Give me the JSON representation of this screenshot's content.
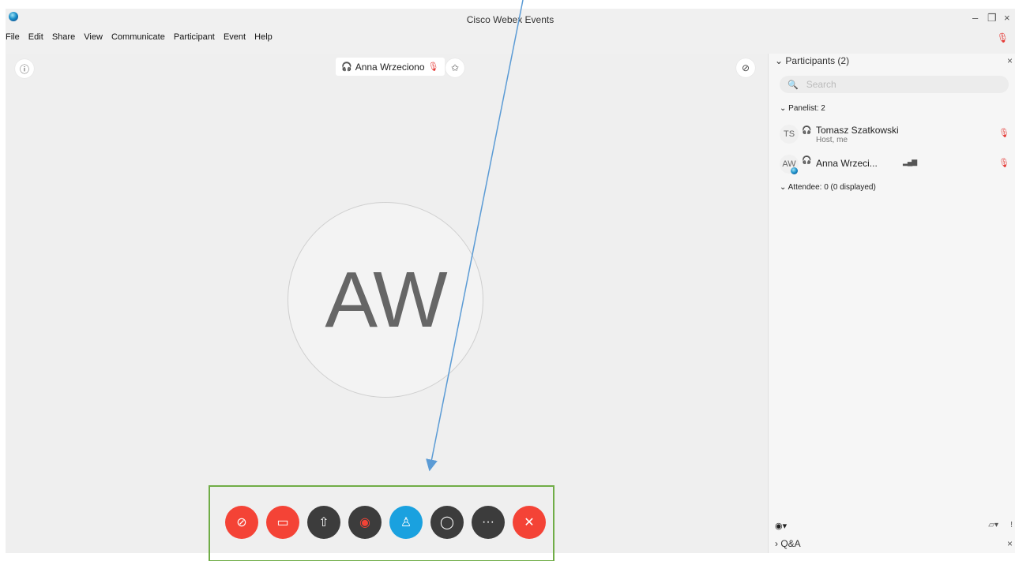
{
  "window": {
    "title": "Cisco Webex Events",
    "minimize_icon": "minimize-icon",
    "restore_icon": "restore-icon",
    "close_icon": "close-icon"
  },
  "menu": [
    "File",
    "Edit",
    "Share",
    "View",
    "Communicate",
    "Participant",
    "Event",
    "Help"
  ],
  "stage": {
    "active_speaker": "Anna Wrzeciono",
    "avatar_initials": "AW"
  },
  "controls": [
    {
      "name": "mute-button",
      "icon": "mic-off-icon",
      "glyph": "🎙̸",
      "style": "red"
    },
    {
      "name": "video-button",
      "icon": "video-off-icon",
      "glyph": "◫",
      "style": "red"
    },
    {
      "name": "share-button",
      "icon": "share-icon",
      "glyph": "⇪",
      "style": "dark"
    },
    {
      "name": "record-button",
      "icon": "record-icon",
      "glyph": "◉",
      "style": "dark"
    },
    {
      "name": "participants-button",
      "icon": "participants-icon",
      "glyph": "👤",
      "style": "blue"
    },
    {
      "name": "chat-button",
      "icon": "chat-icon",
      "glyph": "○",
      "style": "dark"
    },
    {
      "name": "more-button",
      "icon": "more-icon",
      "glyph": "···",
      "style": "dark"
    },
    {
      "name": "leave-button",
      "icon": "close-icon",
      "glyph": "✕",
      "style": "red"
    }
  ],
  "panel": {
    "title": "Participants (2)",
    "search_placeholder": "Search",
    "panelist_label": "Panelist: 2",
    "attendee_label": "Attendee: 0 (0 displayed)",
    "participants": [
      {
        "initials": "TS",
        "name": "Tomasz Szatkowski",
        "role": "Host, me"
      },
      {
        "initials": "AW",
        "name": "Anna Wrzeci...",
        "role": ""
      }
    ],
    "qa_label": "Q&A"
  },
  "colors": {
    "accent_red": "#f44336",
    "accent_blue": "#1aa1df",
    "dark_button": "#3c3c3c",
    "annotation_arrow": "#5b9bd5",
    "annotation_box": "#70ad47"
  }
}
